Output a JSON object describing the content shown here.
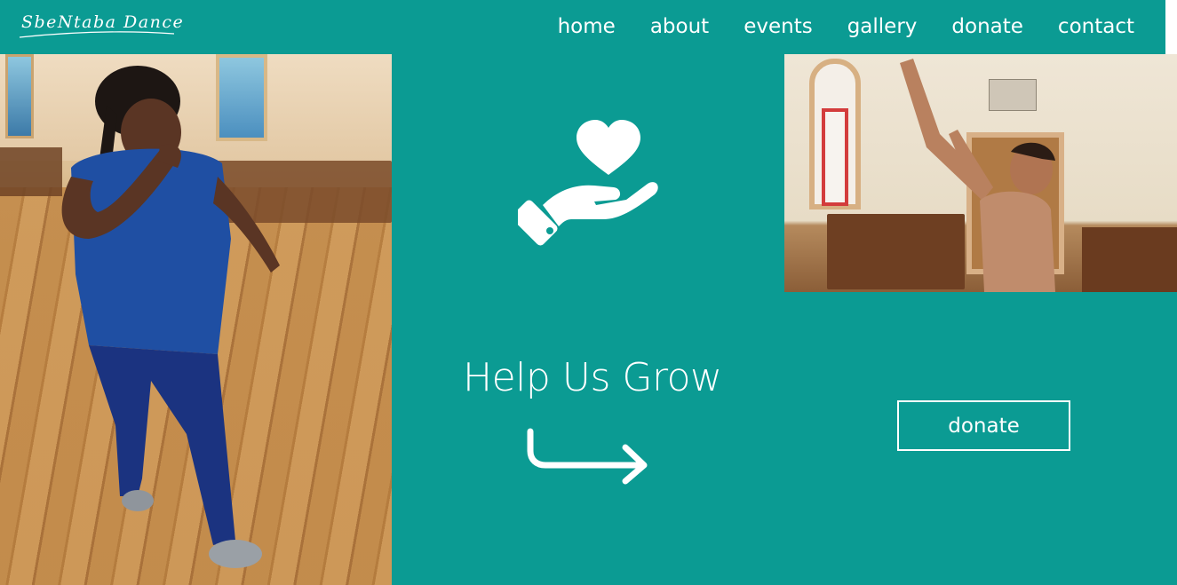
{
  "brand": {
    "logo_text": "SbeNtaba Dance",
    "accent": "#0b9b93"
  },
  "nav": {
    "items": [
      {
        "label": "home"
      },
      {
        "label": "about"
      },
      {
        "label": "events"
      },
      {
        "label": "gallery"
      },
      {
        "label": "donate"
      },
      {
        "label": "contact"
      }
    ]
  },
  "hero": {
    "headline": "Help Us Grow",
    "icon": "heart-in-hand-icon",
    "arrow_icon": "curved-arrow-right-icon"
  },
  "cta": {
    "donate_label": "donate"
  },
  "images": {
    "left": "dancer-in-blue-photo",
    "right": "dancer-in-church-photo"
  }
}
